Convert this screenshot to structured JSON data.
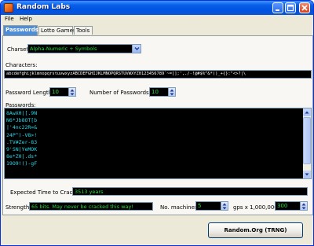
{
  "window": {
    "title": "Random Labs"
  },
  "menu": {
    "file": "File",
    "help": "Help"
  },
  "tabs": [
    "Passwords",
    "Lotto Games",
    "Tools"
  ],
  "charset": {
    "label": "Charset:",
    "value": "Alpha-Numeric + Symbols"
  },
  "characters": {
    "label": "Characters:",
    "value": "abcdefghijklmnopqrstuvwxyzABCDEFGHIJKLMNOPQRSTUVWXYZ0123456789`~=[];',./-!@#$%^&*()_+{}:\"<>?|\\"
  },
  "password_length": {
    "label": "Password Length:",
    "value": "10"
  },
  "number_of_passwords": {
    "label": "Number of Passwords:",
    "value": "10"
  },
  "passwords": {
    "label": "Passwords:",
    "items": [
      "8AwX0|[.9N",
      "N6*Jb8OT[b",
      "|'4nc22R=&",
      "24P^)-V8>!",
      ".TV#Zer-83",
      "9'SN|YeMOK",
      "8e*Z0|.ds*",
      "19O9!()-gF"
    ]
  },
  "crack_time": {
    "label": "Expected Time to Crack:",
    "value": "3513 years"
  },
  "strength": {
    "label": "Strength:",
    "value": "65 bits. May never be cracked this way!"
  },
  "machines": {
    "label": "No. machines:",
    "value": "5"
  },
  "gps": {
    "label": "gps x 1,000,000:",
    "value": "300"
  },
  "actions": {
    "random_org": "Random.Org (TRNG)"
  },
  "colors": {
    "field_bg": "#000000",
    "value_green": "#27d83e",
    "password_cyan": "#28d7e6",
    "titlebar": "#0054e3"
  }
}
